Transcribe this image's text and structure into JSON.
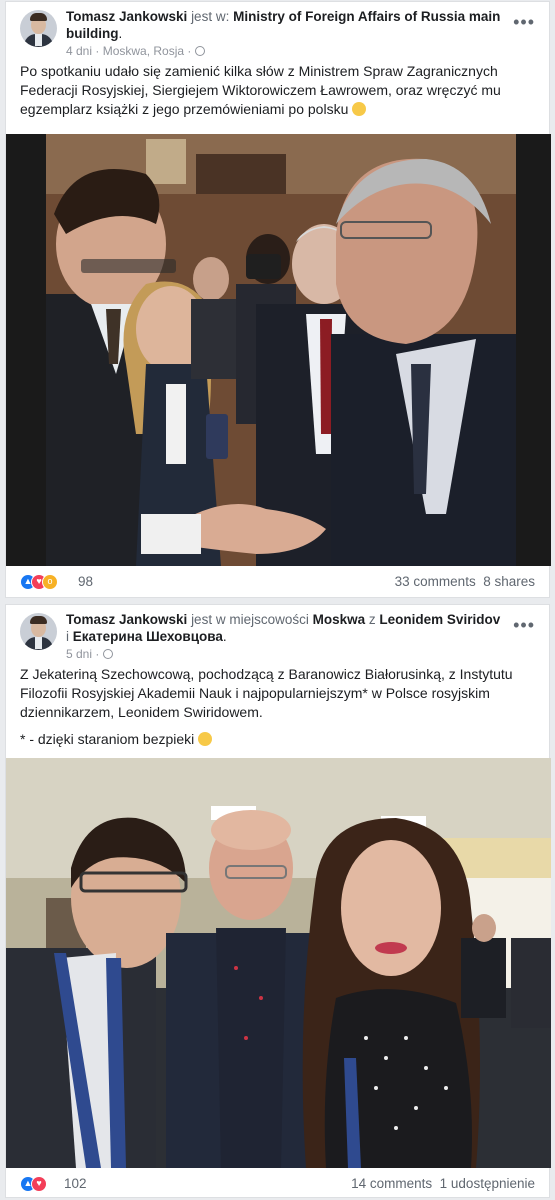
{
  "post1": {
    "author": "Tomasz Jankowski",
    "location_prefix": "jest w:",
    "location": "Ministry of Foreign Affairs of Russia main building",
    "location_suffix": ".",
    "date": "4 dni",
    "place": "Moskwa, Rosja",
    "text": "Po spotkaniu udało się zamienić kilka słów z Ministrem Spraw Zagranicznych Federacji Rosyjskiej, Siergiejem Wiktorowiczem Ławrowem, oraz wręczyć mu egzemplarz książki z jego przemówieniami po polsku",
    "reactions": [
      "like-icon",
      "love-icon",
      "wow-icon"
    ],
    "reaction_count": "98",
    "comments": "33 comments",
    "shares": "8 shares"
  },
  "post2": {
    "author": "Tomasz Jankowski",
    "location_prefix": "jest w miejscowości",
    "location": "Moskwa",
    "with_prefix": "z",
    "tagged1": "Leonidem Sviridov",
    "and": "i",
    "tagged2": "Екатерина Шеховцова",
    "end": ".",
    "date": "5 dni",
    "text": "Z Jekateriną Szechowcową, pochodzącą z Baranowicz Białorusinką, z Instytutu Filozofii Rosyjskiej Akademii Nauk i najpopularniejszym* w Polsce rosyjskim dziennikarzem, Leonidem Swiridowem.",
    "footnote": "* - dzięki staraniom bezpieki",
    "reactions": [
      "like-icon",
      "love-icon"
    ],
    "reaction_count": "102",
    "comments": "14 comments",
    "shares": "1 udostępnienie"
  },
  "menu_label": "•••",
  "colors": {
    "like": "#1877f2",
    "love": "#f33e58",
    "wow": "#f7b125",
    "link": "#1c1e21",
    "muted": "#606770"
  }
}
